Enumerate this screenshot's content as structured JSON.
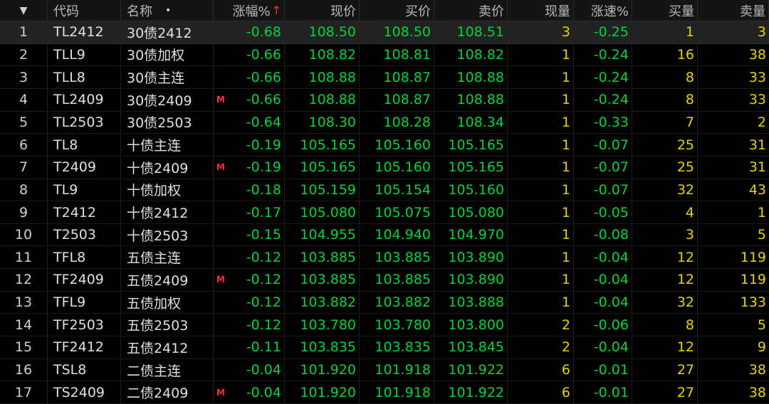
{
  "headers": {
    "menu_glyph": "▼",
    "code": "代码",
    "name": "名称",
    "name_dot": "•",
    "change_pct": "涨幅%",
    "sort_arrow": "↑",
    "last": "现价",
    "bid": "买价",
    "ask": "卖价",
    "volume": "现量",
    "speed": "涨速%",
    "bid_qty": "买量",
    "ask_qty": "卖量"
  },
  "colors": {
    "negative_green": "#00d23c",
    "volume_yellow": "#e6d200",
    "flag_red": "#ff3030",
    "selected_row_bg": "#222222"
  },
  "rows": [
    {
      "idx": "1",
      "code": "TL2412",
      "name": "30债2412",
      "m": "",
      "chg": "-0.68",
      "last": "108.50",
      "bid": "108.50",
      "ask": "108.51",
      "vol": "3",
      "spd": "-0.25",
      "bq": "1",
      "aq": "3"
    },
    {
      "idx": "2",
      "code": "TLL9",
      "name": "30债加权",
      "m": "",
      "chg": "-0.66",
      "last": "108.82",
      "bid": "108.81",
      "ask": "108.82",
      "vol": "1",
      "spd": "-0.24",
      "bq": "16",
      "aq": "38"
    },
    {
      "idx": "3",
      "code": "TLL8",
      "name": "30债主连",
      "m": "",
      "chg": "-0.66",
      "last": "108.88",
      "bid": "108.87",
      "ask": "108.88",
      "vol": "1",
      "spd": "-0.24",
      "bq": "8",
      "aq": "33"
    },
    {
      "idx": "4",
      "code": "TL2409",
      "name": "30债2409",
      "m": "M",
      "chg": "-0.66",
      "last": "108.88",
      "bid": "108.87",
      "ask": "108.88",
      "vol": "1",
      "spd": "-0.24",
      "bq": "8",
      "aq": "33"
    },
    {
      "idx": "5",
      "code": "TL2503",
      "name": "30债2503",
      "m": "",
      "chg": "-0.64",
      "last": "108.30",
      "bid": "108.28",
      "ask": "108.34",
      "vol": "1",
      "spd": "-0.33",
      "bq": "7",
      "aq": "2"
    },
    {
      "idx": "6",
      "code": "TL8",
      "name": "十债主连",
      "m": "",
      "chg": "-0.19",
      "last": "105.165",
      "bid": "105.160",
      "ask": "105.165",
      "vol": "1",
      "spd": "-0.07",
      "bq": "25",
      "aq": "31"
    },
    {
      "idx": "7",
      "code": "T2409",
      "name": "十债2409",
      "m": "M",
      "chg": "-0.19",
      "last": "105.165",
      "bid": "105.160",
      "ask": "105.165",
      "vol": "1",
      "spd": "-0.07",
      "bq": "25",
      "aq": "31"
    },
    {
      "idx": "8",
      "code": "TL9",
      "name": "十债加权",
      "m": "",
      "chg": "-0.18",
      "last": "105.159",
      "bid": "105.154",
      "ask": "105.160",
      "vol": "1",
      "spd": "-0.07",
      "bq": "32",
      "aq": "43"
    },
    {
      "idx": "9",
      "code": "T2412",
      "name": "十债2412",
      "m": "",
      "chg": "-0.17",
      "last": "105.080",
      "bid": "105.075",
      "ask": "105.080",
      "vol": "1",
      "spd": "-0.05",
      "bq": "4",
      "aq": "1"
    },
    {
      "idx": "10",
      "code": "T2503",
      "name": "十债2503",
      "m": "",
      "chg": "-0.15",
      "last": "104.955",
      "bid": "104.940",
      "ask": "104.970",
      "vol": "1",
      "spd": "-0.08",
      "bq": "3",
      "aq": "5"
    },
    {
      "idx": "11",
      "code": "TFL8",
      "name": "五债主连",
      "m": "",
      "chg": "-0.12",
      "last": "103.885",
      "bid": "103.885",
      "ask": "103.890",
      "vol": "1",
      "spd": "-0.04",
      "bq": "12",
      "aq": "119"
    },
    {
      "idx": "12",
      "code": "TF2409",
      "name": "五债2409",
      "m": "M",
      "chg": "-0.12",
      "last": "103.885",
      "bid": "103.885",
      "ask": "103.890",
      "vol": "1",
      "spd": "-0.04",
      "bq": "12",
      "aq": "119"
    },
    {
      "idx": "13",
      "code": "TFL9",
      "name": "五债加权",
      "m": "",
      "chg": "-0.12",
      "last": "103.882",
      "bid": "103.882",
      "ask": "103.888",
      "vol": "1",
      "spd": "-0.04",
      "bq": "32",
      "aq": "133"
    },
    {
      "idx": "14",
      "code": "TF2503",
      "name": "五债2503",
      "m": "",
      "chg": "-0.12",
      "last": "103.780",
      "bid": "103.780",
      "ask": "103.800",
      "vol": "2",
      "spd": "-0.06",
      "bq": "8",
      "aq": "5"
    },
    {
      "idx": "15",
      "code": "TF2412",
      "name": "五债2412",
      "m": "",
      "chg": "-0.11",
      "last": "103.835",
      "bid": "103.835",
      "ask": "103.845",
      "vol": "2",
      "spd": "-0.04",
      "bq": "12",
      "aq": "9"
    },
    {
      "idx": "16",
      "code": "TSL8",
      "name": "二债主连",
      "m": "",
      "chg": "-0.04",
      "last": "101.920",
      "bid": "101.918",
      "ask": "101.922",
      "vol": "6",
      "spd": "-0.01",
      "bq": "27",
      "aq": "38"
    },
    {
      "idx": "17",
      "code": "TS2409",
      "name": "二债2409",
      "m": "M",
      "chg": "-0.04",
      "last": "101.920",
      "bid": "101.918",
      "ask": "101.922",
      "vol": "6",
      "spd": "-0.01",
      "bq": "27",
      "aq": "38"
    }
  ]
}
